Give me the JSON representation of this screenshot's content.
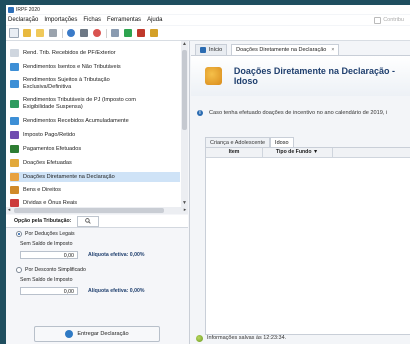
{
  "window": {
    "title": "IRPF 2020"
  },
  "menu": [
    "Declaração",
    "Importações",
    "Fichas",
    "Ferramentas",
    "Ajuda"
  ],
  "contribuinte_label": "Contribu",
  "toolbar": {
    "icons": [
      "new-file-icon",
      "open-folder-icon",
      "open-folder-icon",
      "delete-icon",
      "transmit-icon",
      "print-icon",
      "receipt-icon",
      "chart-icon",
      "check-icon",
      "clipboard-icon",
      "book-icon"
    ]
  },
  "sidebar": {
    "items": [
      {
        "label": "Rend. Trib. Recebidos de PF/Exterior",
        "icon": "document-icon",
        "color": "#cfd6df"
      },
      {
        "label": "Rendimentos Isentos e Não Tributáveis",
        "icon": "coins-icon",
        "color": "#3d8fd6"
      },
      {
        "label": "Rendimentos Sujeitos à Tributação",
        "label2": "Exclusiva/Definitiva",
        "icon": "coins-icon",
        "color": "#3d8fd6"
      },
      {
        "label": "Rendimentos Tributáveis de PJ (Imposto com",
        "label2": "Exigibilidade Suspensa)",
        "icon": "money-icon",
        "color": "#2e9b5f"
      },
      {
        "label": "Rendimentos Recebidos Acumuladamente",
        "icon": "coins-icon",
        "color": "#3d8fd6"
      },
      {
        "label": "Imposto Pago/Retido",
        "icon": "tax-icon",
        "color": "#6f4cb0"
      },
      {
        "label": "Pagamentos Efetuados",
        "icon": "card-icon",
        "color": "#2e7d32"
      },
      {
        "label": "Doações Efetuadas",
        "icon": "gift-icon",
        "color": "#e2a93b"
      },
      {
        "label": "Doações Diretamente na Declaração",
        "icon": "hands-icon",
        "color": "#e8a240"
      },
      {
        "label": "Bens e Direitos",
        "icon": "house-icon",
        "color": "#d08a2a"
      },
      {
        "label": "Dívidas e Ônus Reais",
        "icon": "debt-icon",
        "color": "#cc3b3b"
      }
    ],
    "selected_index": 8
  },
  "tax_option": {
    "title": "Opção pela Tributação:",
    "deducoes": {
      "label": "Por Deduções Legais",
      "saldo_label": "Sem Saldo de Imposto",
      "value": "0,00",
      "aliquota": "Alíquota efetiva: 0,00%"
    },
    "simplificado": {
      "label": "Por Desconto Simplificado",
      "saldo_label": "Sem Saldo de Imposto",
      "value": "0,00",
      "aliquota": "Alíquota efetiva: 0,00%"
    },
    "selected": "deducoes"
  },
  "entregar_label": "Entregar Declaração",
  "tabs": [
    {
      "label": "Início"
    },
    {
      "label": "Doações Diretamente na Declaração"
    }
  ],
  "tab_close": "×",
  "page_title": "Doações Diretamente na Declaração - Idoso",
  "info_text": "Caso tenha efetuado doações de incentivo no ano calendário de 2019, i",
  "subtabs": [
    "Criança e Adolescente",
    "Idoso"
  ],
  "active_subtab": "Idoso",
  "table": {
    "columns": [
      "Item",
      "Tipo de Fundo ▼"
    ]
  },
  "status_text": "Informações salvas às 12:23:34."
}
